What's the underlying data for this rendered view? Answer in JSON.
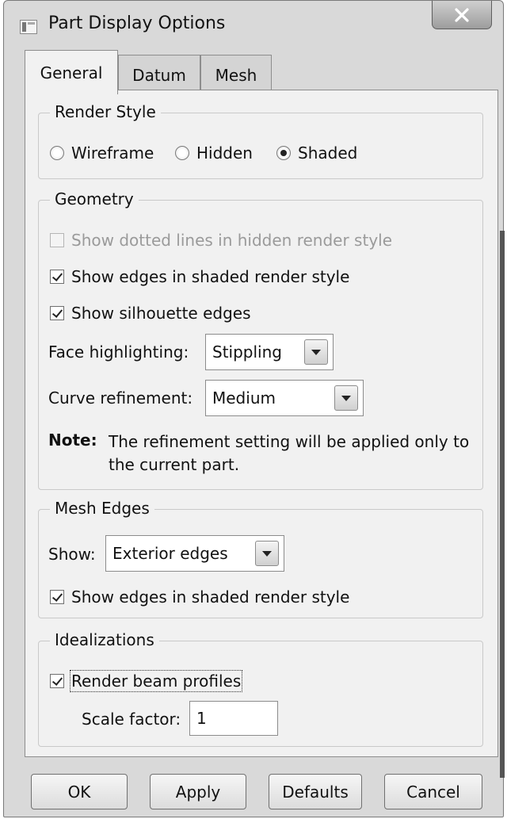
{
  "window": {
    "title": "Part Display Options",
    "close_icon": "close-x-icon",
    "app_icon": "window-app-icon"
  },
  "tabs": [
    {
      "label": "General",
      "active": true
    },
    {
      "label": "Datum",
      "active": false
    },
    {
      "label": "Mesh",
      "active": false
    }
  ],
  "render_style": {
    "title": "Render Style",
    "options": [
      {
        "label": "Wireframe",
        "checked": false
      },
      {
        "label": "Hidden",
        "checked": false
      },
      {
        "label": "Shaded",
        "checked": true
      }
    ]
  },
  "geometry": {
    "title": "Geometry",
    "show_dotted_lines": {
      "label": "Show dotted lines in hidden render style",
      "checked": false,
      "disabled": true
    },
    "show_edges": {
      "label": "Show edges in shaded render style",
      "checked": true
    },
    "show_silhouette": {
      "label": "Show silhouette edges",
      "checked": true
    },
    "face_highlighting": {
      "label": "Face highlighting:",
      "value": "Stippling"
    },
    "curve_refinement": {
      "label": "Curve refinement:",
      "value": "Medium"
    },
    "note": {
      "key": "Note:",
      "text": "The refinement setting will be applied only to the current part."
    }
  },
  "mesh_edges": {
    "title": "Mesh Edges",
    "show": {
      "label": "Show:",
      "value": "Exterior edges"
    },
    "show_edges": {
      "label": "Show edges in shaded render style",
      "checked": true
    }
  },
  "idealizations": {
    "title": "Idealizations",
    "render_beam_profiles": {
      "label": "Render beam profiles",
      "checked": true
    },
    "scale_factor": {
      "label": "Scale factor:",
      "value": "1"
    }
  },
  "buttons": {
    "ok": "OK",
    "apply": "Apply",
    "defaults": "Defaults",
    "cancel": "Cancel"
  }
}
